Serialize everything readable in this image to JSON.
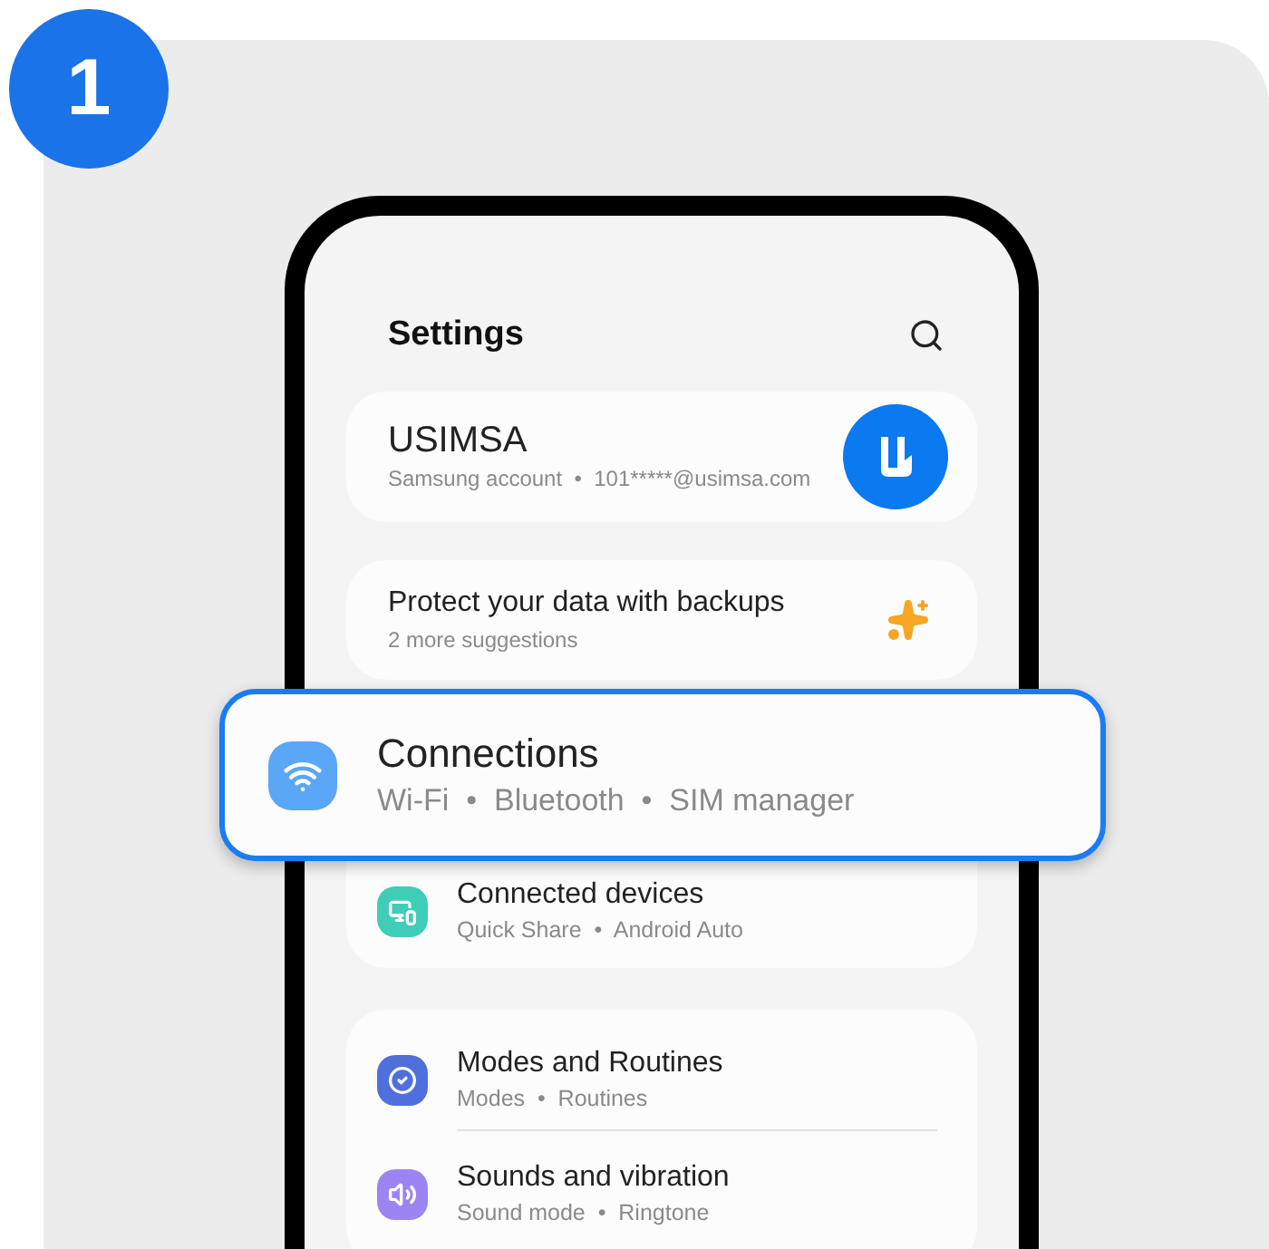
{
  "step_badge": "1",
  "header": {
    "title": "Settings"
  },
  "account": {
    "name": "USIMSA",
    "detail": "Samsung account  •  101*****@usimsa.com"
  },
  "suggestion": {
    "title": "Protect your data with backups",
    "subtitle": "2 more suggestions"
  },
  "highlighted_item": {
    "kind": "wifi",
    "title": "Connections",
    "subtitle": "Wi-Fi  •  Bluetooth  •  SIM manager"
  },
  "groups": [
    {
      "items": [
        {
          "kind": "devices",
          "title": "Connected devices",
          "subtitle": "Quick Share  •  Android Auto"
        }
      ]
    },
    {
      "items": [
        {
          "kind": "modes",
          "title": "Modes and Routines",
          "subtitle": "Modes  •  Routines"
        },
        {
          "kind": "sound",
          "title": "Sounds and vibration",
          "subtitle": "Sound mode  •  Ringtone"
        }
      ]
    }
  ]
}
